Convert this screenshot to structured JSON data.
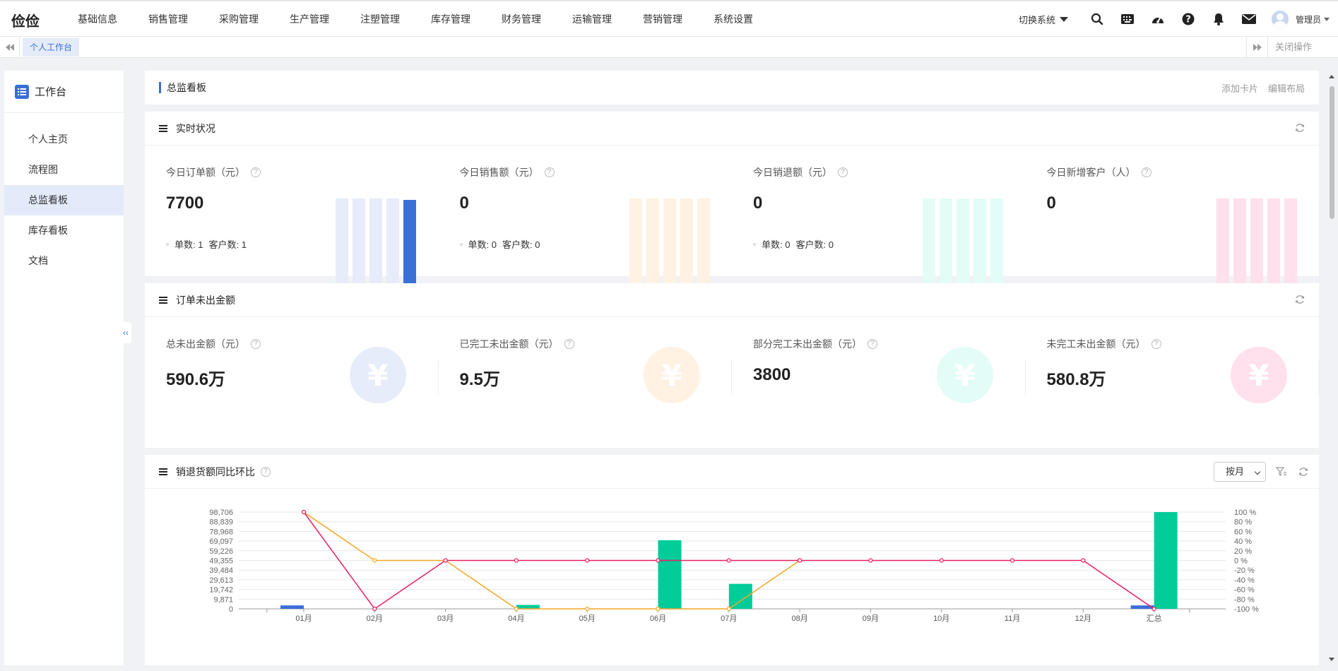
{
  "app": {
    "logo": "俭俭",
    "nav": [
      "基础信息",
      "销售管理",
      "采购管理",
      "生产管理",
      "注塑管理",
      "库存管理",
      "财务管理",
      "运输管理",
      "营销管理",
      "系统设置"
    ],
    "switch_system": "切换系统",
    "user": "管理员",
    "icons": [
      "search-icon",
      "keyboard-icon",
      "dashboard-icon",
      "help-icon",
      "bell-icon",
      "mail-icon"
    ]
  },
  "tabs": {
    "active": "个人工作台",
    "close_ops": "关闭操作"
  },
  "sidebar": {
    "title": "工作台",
    "items": [
      "个人主页",
      "流程图",
      "总监看板",
      "库存看板",
      "文档"
    ],
    "active_index": 2,
    "collapse": "‹‹"
  },
  "board": {
    "title": "总监看板",
    "add_card": "添加卡片",
    "edit_layout": "编辑布局"
  },
  "realtime": {
    "title": "实时状况",
    "stats": [
      {
        "label": "今日订单额（元）",
        "value": "7700",
        "sub1": "单数: 1",
        "sub2": "客户数: 1",
        "bar_color": "#e6ecf9",
        "accent": "#3b6fd8",
        "highlight": true
      },
      {
        "label": "今日销售额（元）",
        "value": "0",
        "sub1": "单数: 0",
        "sub2": "客户数: 0",
        "bar_color": "#fff2e3",
        "accent": "#f5a623",
        "highlight": false
      },
      {
        "label": "今日销退额（元）",
        "value": "0",
        "sub1": "单数: 0",
        "sub2": "客户数: 0",
        "bar_color": "#e3fcf8",
        "accent": "#20c9b0",
        "highlight": false
      },
      {
        "label": "今日新增客户（人）",
        "value": "0",
        "sub1": "",
        "sub2": "",
        "bar_color": "#ffe0ec",
        "accent": "#f06292",
        "highlight": false
      }
    ]
  },
  "unshipped": {
    "title": "订单未出金额",
    "items": [
      {
        "label": "总未出金额（元）",
        "value": "590.6万",
        "circle": "#e6ecf9"
      },
      {
        "label": "已完工未出金额（元）",
        "value": "9.5万",
        "circle": "#fff2e3"
      },
      {
        "label": "部分完工未出金额（元）",
        "value": "3800",
        "circle": "#e3fcf8"
      },
      {
        "label": "未完工未出金额（元）",
        "value": "580.8万",
        "circle": "#ffe0ec"
      }
    ],
    "yen": "¥"
  },
  "chart_section": {
    "title": "销退货额同比环比",
    "period": "按月"
  },
  "chart_data": {
    "type": "bar",
    "title": "",
    "categories": [
      "01月",
      "02月",
      "03月",
      "04月",
      "05月",
      "06月",
      "07月",
      "08月",
      "09月",
      "10月",
      "11月",
      "12月",
      "汇总"
    ],
    "y_ticks": [
      "0",
      "9,871",
      "19,742",
      "29,613",
      "39,484",
      "49,355",
      "59,226",
      "69,097",
      "78,968",
      "88,839",
      "98,706"
    ],
    "ylim": [
      0,
      98706
    ],
    "y2_ticks": [
      "-100 %",
      "-80 %",
      "-60 %",
      "-40 %",
      "-20 %",
      "0 %",
      "20 %",
      "40 %",
      "60 %",
      "80 %",
      "100 %"
    ],
    "y2lim": [
      -100,
      100
    ],
    "series": [
      {
        "type": "bar",
        "values": [
          3500,
          0,
          0,
          0,
          0,
          0,
          0,
          0,
          0,
          0,
          0,
          0,
          3500
        ],
        "color": "#3b6fd8"
      },
      {
        "type": "bar",
        "values": [
          0,
          0,
          0,
          4000,
          0,
          70000,
          25500,
          0,
          0,
          0,
          0,
          0,
          98706
        ],
        "color": "#00cc99"
      },
      {
        "type": "line",
        "axis": "right",
        "values": [
          100,
          0,
          0,
          -100,
          -100,
          -100,
          -100,
          0,
          null,
          null,
          null,
          null,
          null
        ],
        "color": "#f5a623"
      },
      {
        "type": "line",
        "axis": "right",
        "values": [
          100,
          -100,
          0,
          0,
          0,
          0,
          0,
          0,
          0,
          0,
          0,
          0,
          -100
        ],
        "color": "#e91e63"
      }
    ],
    "grid": true
  }
}
